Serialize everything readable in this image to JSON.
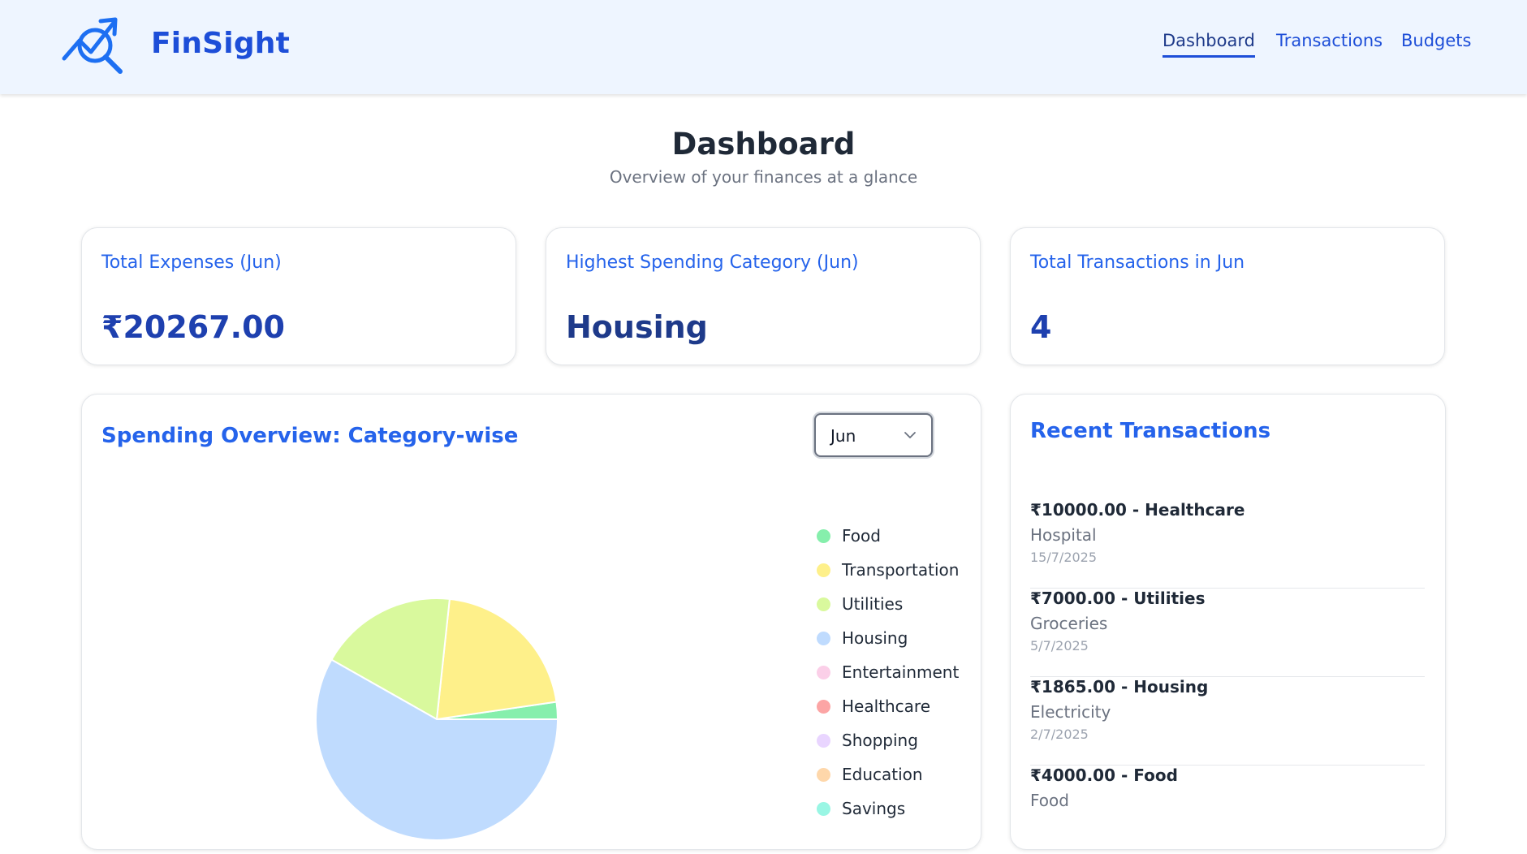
{
  "header": {
    "brand": "FinSight",
    "nav": [
      {
        "label": "Dashboard",
        "active": true
      },
      {
        "label": "Transactions",
        "active": false
      },
      {
        "label": "Budgets",
        "active": false
      }
    ]
  },
  "page": {
    "title": "Dashboard",
    "subtitle": "Overview of your finances at a glance"
  },
  "stats": [
    {
      "label": "Total Expenses (Jun)",
      "value": "₹20267.00"
    },
    {
      "label": "Highest Spending Category (Jun)",
      "value": "Housing"
    },
    {
      "label": "Total Transactions in Jun",
      "value": "4"
    }
  ],
  "spending": {
    "title": "Spending Overview: Category-wise",
    "selected_month": "Jun"
  },
  "chart_data": {
    "type": "pie",
    "title": "",
    "slices": [
      {
        "label": "Food",
        "value": 2.3,
        "color": "#86efac"
      },
      {
        "label": "Transportation",
        "value": 21.0,
        "color": "#fef08a"
      },
      {
        "label": "Utilities",
        "value": 18.5,
        "color": "#d9f99d"
      },
      {
        "label": "Housing",
        "value": 58.2,
        "color": "#bfdbfe"
      },
      {
        "label": "Entertainment",
        "value": 0,
        "color": "#fbcfe8"
      },
      {
        "label": "Healthcare",
        "value": 0,
        "color": "#fca5a5"
      },
      {
        "label": "Shopping",
        "value": 0,
        "color": "#e9d5ff"
      },
      {
        "label": "Education",
        "value": 0,
        "color": "#fed7aa"
      },
      {
        "label": "Savings",
        "value": 0,
        "color": "#99f6e4"
      }
    ],
    "legend_position": "right"
  },
  "recent": {
    "title": "Recent Transactions",
    "items": [
      {
        "main": "₹10000.00 - Healthcare",
        "desc": "Hospital",
        "date": "15/7/2025"
      },
      {
        "main": "₹7000.00 - Utilities",
        "desc": "Groceries",
        "date": "5/7/2025"
      },
      {
        "main": "₹1865.00 - Housing",
        "desc": "Electricity",
        "date": "2/7/2025"
      },
      {
        "main": "₹4000.00 - Food",
        "desc": "Food",
        "date": ""
      }
    ]
  },
  "colors": {
    "brand": "#1d4ed8",
    "accent": "#2563eb",
    "header_bg": "#eef5ff"
  }
}
